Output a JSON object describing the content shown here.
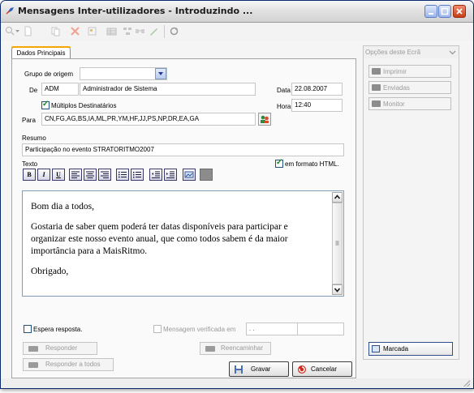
{
  "window": {
    "title": "Mensagens Inter-utilizadores - Introduzindo ..."
  },
  "tabs": {
    "main": "Dados Principais"
  },
  "form": {
    "grupo_label": "Grupo de origem",
    "grupo_value": "",
    "de_label": "De",
    "de_code": "ADM",
    "de_name": "Administrador de Sistema",
    "data_label": "Data",
    "data_value": "22.08.2007",
    "hora_label": "Hora",
    "hora_value": "12:40",
    "multiplos_label": "Múltiplos Destinatários",
    "multiplos_checked": true,
    "para_label": "Para",
    "para_value": "CN,FG,AG,BS,IA,ML,PR,YM,HF,JJ,PS,NP,DR,EA,GA",
    "resumo_label": "Resumo",
    "resumo_value": "Participação no evento STRATORITMO2007",
    "texto_label": "Texto",
    "html_label": "em formato HTML.",
    "html_checked": true,
    "format_buttons": {
      "bold": "B",
      "italic": "I",
      "underline": "U"
    },
    "body_lines": [
      "Bom dia a todos,",
      "Gostaria de saber quem poderá ter datas disponíveis para participar e organizar este nosso evento anual, que como todos sabem é da maior importância para a MaisRitmo.",
      "Obrigado,"
    ],
    "espera_label": "Espera resposta.",
    "verificada_label": "Mensagem verificada em",
    "verificada_date": " .  .",
    "verificada_time": "",
    "responder_label": "Responder",
    "reencaminhar_label": "Reencaminhar",
    "responder_todos_label": "Responder a todos"
  },
  "sidebar": {
    "header": "Opções deste Ecrã",
    "items": [
      {
        "label": "Imprimir"
      },
      {
        "label": "Enviadas"
      },
      {
        "label": "Monitor"
      }
    ],
    "marcada_label": "Marcada"
  },
  "actions": {
    "gravar": "Gravar",
    "cancelar": "Cancelar"
  }
}
